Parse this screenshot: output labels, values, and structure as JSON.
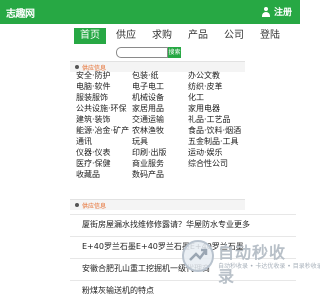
{
  "header": {
    "logo": "志趣网",
    "register": "注册"
  },
  "nav": {
    "items": [
      {
        "label": "首页",
        "active": true
      },
      {
        "label": "供应",
        "active": false
      },
      {
        "label": "求购",
        "active": false
      },
      {
        "label": "产品",
        "active": false
      },
      {
        "label": "公司",
        "active": false
      },
      {
        "label": "登陆",
        "active": false
      }
    ]
  },
  "search": {
    "value": "",
    "button_label": "搜索"
  },
  "supply": {
    "title": "供应信息",
    "categories": [
      "安全·防护",
      "包装·纸",
      "办公文教",
      "电脑·软件",
      "电子电工",
      "纺织·皮革",
      "服装服饰",
      "机械设备",
      "化工",
      "公共设施·环保",
      "家居用品",
      "家用电器",
      "建筑·装饰",
      "交通运输",
      "礼品·工艺品",
      "能源·冶金·矿产",
      "农林渔牧",
      "食品·饮料·烟酒",
      "通讯",
      "玩具",
      "五金制品·工具",
      "仪器·仪表",
      "印刷·出版",
      "运动·娱乐",
      "医疗·保健",
      "商业服务",
      "综合性公司",
      "收藏品",
      "数码产品",
      ""
    ]
  },
  "news": {
    "title": "供应信息",
    "items": [
      "厦街房屋漏水找维修修露请？华屋防水专业更多",
      "E+40罗兰石墨E+40罗兰石墨E+40罗兰石墨",
      "安徽合肥孔山重工挖掘机一级代理商",
      "粉煤灰输送机的特点"
    ]
  },
  "watermark": {
    "title": "自动秒收录",
    "subtitle": "自动秒收录 • 卡达优收录 • 目录秒收录"
  },
  "colors": {
    "brand_green": "#27a844",
    "section_title_orange": "#e56a2a"
  }
}
